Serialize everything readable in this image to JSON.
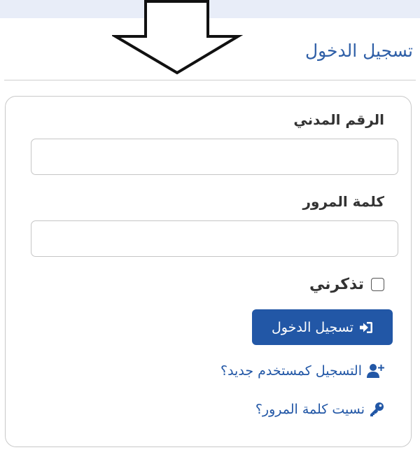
{
  "page": {
    "title": "تسجيل الدخول"
  },
  "form": {
    "civil_id_label": "الرقم المدني",
    "civil_id_value": "",
    "password_label": "كلمة المرور",
    "password_value": "",
    "remember_label": "تذكرني",
    "remember_checked": false,
    "login_button_label": "تسجيل الدخول",
    "register_link": "التسجيل كمستخدم جديد؟",
    "forgot_link": "نسيت كلمة المرور؟"
  },
  "icons": {
    "annotation_arrow": "down-arrow-icon",
    "login": "sign-in-icon",
    "register": "user-plus-icon",
    "forgot": "key-icon"
  },
  "colors": {
    "accent": "#2257a6",
    "title": "#2f5fa7",
    "top_strip": "#e8edf8"
  }
}
